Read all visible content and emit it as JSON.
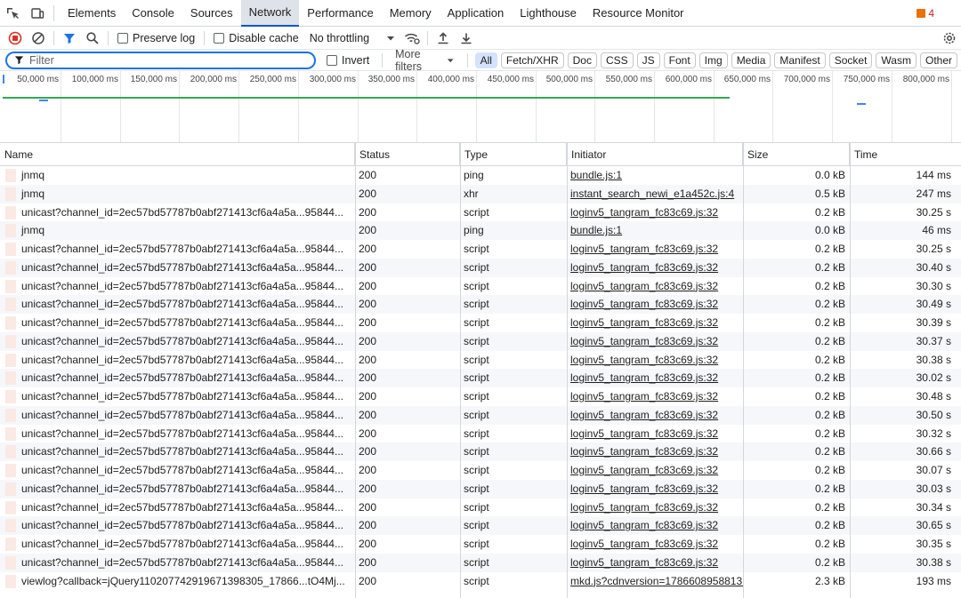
{
  "tabs": [
    "Elements",
    "Console",
    "Sources",
    "Network",
    "Performance",
    "Memory",
    "Application",
    "Lighthouse",
    "Resource Monitor"
  ],
  "active_tab": "Network",
  "issues_count": "4",
  "toolbar": {
    "preserve_log": "Preserve log",
    "disable_cache": "Disable cache",
    "throttling": "No throttling"
  },
  "filter": {
    "placeholder": "Filter",
    "invert": "Invert",
    "more_filters": "More filters",
    "types": [
      "All",
      "Fetch/XHR",
      "Doc",
      "CSS",
      "JS",
      "Font",
      "Img",
      "Media",
      "Manifest",
      "Socket",
      "Wasm",
      "Other"
    ],
    "active_type": "All"
  },
  "overview": {
    "ticks": [
      "50,000 ms",
      "100,000 ms",
      "150,000 ms",
      "200,000 ms",
      "250,000 ms",
      "300,000 ms",
      "350,000 ms",
      "400,000 ms",
      "450,000 ms",
      "500,000 ms",
      "550,000 ms",
      "600,000 ms",
      "650,000 ms",
      "700,000 ms",
      "750,000 ms",
      "800,000 ms"
    ],
    "colors": {
      "green": "#34a853",
      "blue": "#4285f4"
    }
  },
  "columns": {
    "name": "Name",
    "status": "Status",
    "type": "Type",
    "initiator": "Initiator",
    "size": "Size",
    "time": "Time"
  },
  "rows": [
    {
      "name": "jnmq",
      "status": "200",
      "type": "ping",
      "initiator": "bundle.js:1",
      "size": "0.0 kB",
      "time": "144 ms"
    },
    {
      "name": "jnmq",
      "status": "200",
      "type": "xhr",
      "initiator": "instant_search_newi_e1a452c.js:4",
      "size": "0.5 kB",
      "time": "247 ms"
    },
    {
      "name": "unicast?channel_id=2ec57bd57787b0abf271413cf6a4a5a...95844...",
      "status": "200",
      "type": "script",
      "initiator": "loginv5_tangram_fc83c69.js:32",
      "size": "0.2 kB",
      "time": "30.25 s"
    },
    {
      "name": "jnmq",
      "status": "200",
      "type": "ping",
      "initiator": "bundle.js:1",
      "size": "0.0 kB",
      "time": "46 ms"
    },
    {
      "name": "unicast?channel_id=2ec57bd57787b0abf271413cf6a4a5a...95844...",
      "status": "200",
      "type": "script",
      "initiator": "loginv5_tangram_fc83c69.js:32",
      "size": "0.2 kB",
      "time": "30.25 s"
    },
    {
      "name": "unicast?channel_id=2ec57bd57787b0abf271413cf6a4a5a...95844...",
      "status": "200",
      "type": "script",
      "initiator": "loginv5_tangram_fc83c69.js:32",
      "size": "0.2 kB",
      "time": "30.40 s"
    },
    {
      "name": "unicast?channel_id=2ec57bd57787b0abf271413cf6a4a5a...95844...",
      "status": "200",
      "type": "script",
      "initiator": "loginv5_tangram_fc83c69.js:32",
      "size": "0.2 kB",
      "time": "30.30 s"
    },
    {
      "name": "unicast?channel_id=2ec57bd57787b0abf271413cf6a4a5a...95844...",
      "status": "200",
      "type": "script",
      "initiator": "loginv5_tangram_fc83c69.js:32",
      "size": "0.2 kB",
      "time": "30.49 s"
    },
    {
      "name": "unicast?channel_id=2ec57bd57787b0abf271413cf6a4a5a...95844...",
      "status": "200",
      "type": "script",
      "initiator": "loginv5_tangram_fc83c69.js:32",
      "size": "0.2 kB",
      "time": "30.39 s"
    },
    {
      "name": "unicast?channel_id=2ec57bd57787b0abf271413cf6a4a5a...95844...",
      "status": "200",
      "type": "script",
      "initiator": "loginv5_tangram_fc83c69.js:32",
      "size": "0.2 kB",
      "time": "30.37 s"
    },
    {
      "name": "unicast?channel_id=2ec57bd57787b0abf271413cf6a4a5a...95844...",
      "status": "200",
      "type": "script",
      "initiator": "loginv5_tangram_fc83c69.js:32",
      "size": "0.2 kB",
      "time": "30.38 s"
    },
    {
      "name": "unicast?channel_id=2ec57bd57787b0abf271413cf6a4a5a...95844...",
      "status": "200",
      "type": "script",
      "initiator": "loginv5_tangram_fc83c69.js:32",
      "size": "0.2 kB",
      "time": "30.02 s"
    },
    {
      "name": "unicast?channel_id=2ec57bd57787b0abf271413cf6a4a5a...95844...",
      "status": "200",
      "type": "script",
      "initiator": "loginv5_tangram_fc83c69.js:32",
      "size": "0.2 kB",
      "time": "30.48 s"
    },
    {
      "name": "unicast?channel_id=2ec57bd57787b0abf271413cf6a4a5a...95844...",
      "status": "200",
      "type": "script",
      "initiator": "loginv5_tangram_fc83c69.js:32",
      "size": "0.2 kB",
      "time": "30.50 s"
    },
    {
      "name": "unicast?channel_id=2ec57bd57787b0abf271413cf6a4a5a...95844...",
      "status": "200",
      "type": "script",
      "initiator": "loginv5_tangram_fc83c69.js:32",
      "size": "0.2 kB",
      "time": "30.32 s"
    },
    {
      "name": "unicast?channel_id=2ec57bd57787b0abf271413cf6a4a5a...95844...",
      "status": "200",
      "type": "script",
      "initiator": "loginv5_tangram_fc83c69.js:32",
      "size": "0.2 kB",
      "time": "30.66 s"
    },
    {
      "name": "unicast?channel_id=2ec57bd57787b0abf271413cf6a4a5a...95844...",
      "status": "200",
      "type": "script",
      "initiator": "loginv5_tangram_fc83c69.js:32",
      "size": "0.2 kB",
      "time": "30.07 s"
    },
    {
      "name": "unicast?channel_id=2ec57bd57787b0abf271413cf6a4a5a...95844...",
      "status": "200",
      "type": "script",
      "initiator": "loginv5_tangram_fc83c69.js:32",
      "size": "0.2 kB",
      "time": "30.03 s"
    },
    {
      "name": "unicast?channel_id=2ec57bd57787b0abf271413cf6a4a5a...95844...",
      "status": "200",
      "type": "script",
      "initiator": "loginv5_tangram_fc83c69.js:32",
      "size": "0.2 kB",
      "time": "30.34 s"
    },
    {
      "name": "unicast?channel_id=2ec57bd57787b0abf271413cf6a4a5a...95844...",
      "status": "200",
      "type": "script",
      "initiator": "loginv5_tangram_fc83c69.js:32",
      "size": "0.2 kB",
      "time": "30.65 s"
    },
    {
      "name": "unicast?channel_id=2ec57bd57787b0abf271413cf6a4a5a...95844...",
      "status": "200",
      "type": "script",
      "initiator": "loginv5_tangram_fc83c69.js:32",
      "size": "0.2 kB",
      "time": "30.35 s"
    },
    {
      "name": "unicast?channel_id=2ec57bd57787b0abf271413cf6a4a5a...95844...",
      "status": "200",
      "type": "script",
      "initiator": "loginv5_tangram_fc83c69.js:32",
      "size": "0.2 kB",
      "time": "30.38 s"
    },
    {
      "name": "viewlog?callback=jQuery110207742919671398305_17866...tO4Mj...",
      "status": "200",
      "type": "script",
      "initiator": "mkd.js?cdnversion=1786608958813:",
      "size": "2.3 kB",
      "time": "193 ms"
    }
  ]
}
